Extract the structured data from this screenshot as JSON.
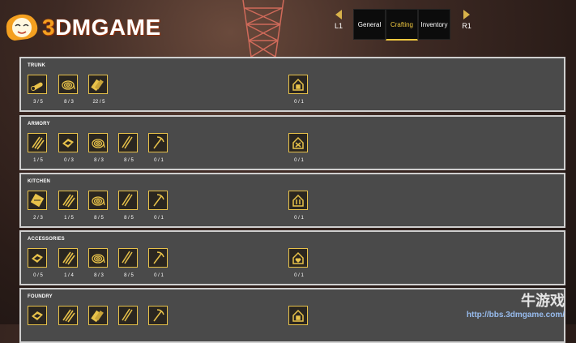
{
  "logo": {
    "prefix": "3",
    "text": "DMGAME"
  },
  "nav": {
    "left_label": "L1",
    "right_label": "R1",
    "tabs": [
      {
        "label": "General",
        "active": false
      },
      {
        "label": "Crafting",
        "active": true
      },
      {
        "label": "Inventory",
        "active": false
      }
    ]
  },
  "colors": {
    "accent": "#e8c24a",
    "panel": "#4a4a4a",
    "panel_border": "#cfcfcf"
  },
  "panels": [
    {
      "title": "TRUNK",
      "items": [
        {
          "icon": "logs-icon",
          "count": "3 / 5"
        },
        {
          "icon": "rope-coil-icon",
          "count": "8 / 3"
        },
        {
          "icon": "planks-icon",
          "count": "22 / 5"
        }
      ],
      "destination": {
        "icon": "house-storage-icon",
        "count": "0 / 1"
      }
    },
    {
      "title": "ARMORY",
      "items": [
        {
          "icon": "arrows-icon",
          "count": "1 / 5"
        },
        {
          "icon": "cloth-icon",
          "count": "0 / 3"
        },
        {
          "icon": "rope-coil-icon",
          "count": "8 / 3"
        },
        {
          "icon": "sticks-icon",
          "count": "8 / 5"
        },
        {
          "icon": "pickaxe-icon",
          "count": "0 / 1"
        }
      ],
      "destination": {
        "icon": "house-crossed-icon",
        "count": "0 / 1"
      }
    },
    {
      "title": "KITCHEN",
      "items": [
        {
          "icon": "planks-bundle-icon",
          "count": "2 / 3"
        },
        {
          "icon": "arrows-icon",
          "count": "1 / 5"
        },
        {
          "icon": "rope-coil-icon",
          "count": "8 / 5"
        },
        {
          "icon": "sticks-icon",
          "count": "8 / 5"
        },
        {
          "icon": "pickaxe-icon",
          "count": "0 / 1"
        }
      ],
      "destination": {
        "icon": "house-utensils-icon",
        "count": "0 / 1"
      }
    },
    {
      "title": "ACCESSORIES",
      "items": [
        {
          "icon": "cloth-icon",
          "count": "0 / 5"
        },
        {
          "icon": "arrows-icon",
          "count": "1 / 4"
        },
        {
          "icon": "rope-coil-icon",
          "count": "8 / 3"
        },
        {
          "icon": "sticks-icon",
          "count": "8 / 5"
        },
        {
          "icon": "pickaxe-icon",
          "count": "0 / 1"
        }
      ],
      "destination": {
        "icon": "house-heart-icon",
        "count": "0 / 1"
      }
    },
    {
      "title": "FOUNDRY",
      "items": [
        {
          "icon": "cloth-icon",
          "count": ""
        },
        {
          "icon": "arrows-icon",
          "count": ""
        },
        {
          "icon": "planks-icon",
          "count": ""
        },
        {
          "icon": "sticks-icon",
          "count": ""
        },
        {
          "icon": "pickaxe-icon",
          "count": ""
        }
      ],
      "destination": {
        "icon": "house-storage-icon",
        "count": ""
      }
    }
  ],
  "watermark": {
    "title": "牛游戏",
    "url": "http://bbs.3dmgame.com/"
  }
}
